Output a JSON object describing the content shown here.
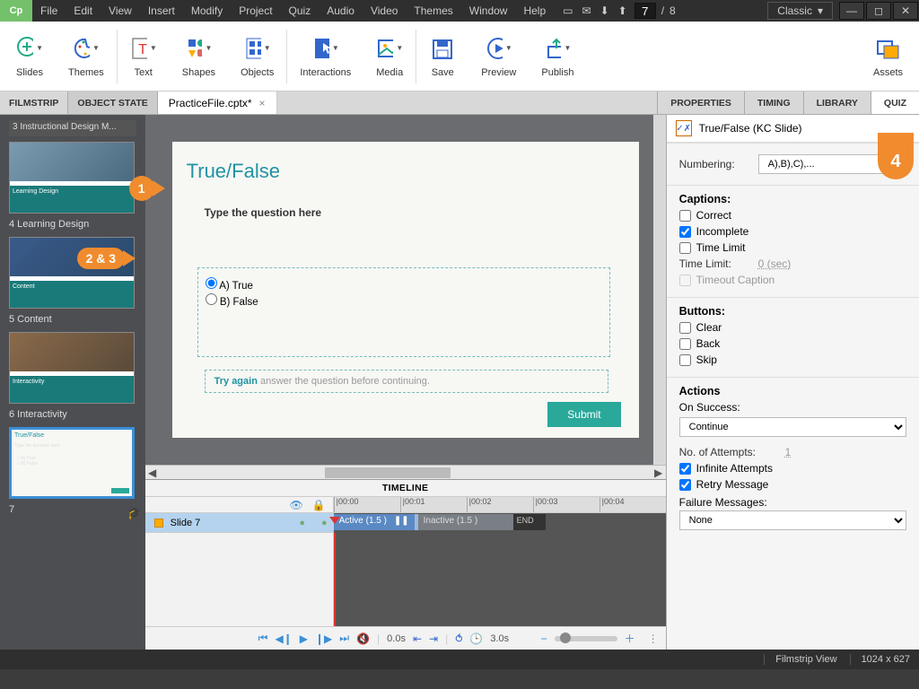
{
  "app": {
    "logo": "Cp"
  },
  "menu": [
    "File",
    "Edit",
    "View",
    "Insert",
    "Modify",
    "Project",
    "Quiz",
    "Audio",
    "Video",
    "Themes",
    "Window",
    "Help"
  ],
  "slideCounter": {
    "current": "7",
    "sep": "/",
    "total": "8"
  },
  "workspace": "Classic",
  "ribbon": [
    {
      "label": "Slides"
    },
    {
      "label": "Themes"
    },
    {
      "label": "Text"
    },
    {
      "label": "Shapes"
    },
    {
      "label": "Objects"
    },
    {
      "label": "Interactions"
    },
    {
      "label": "Media"
    },
    {
      "label": "Save"
    },
    {
      "label": "Preview"
    },
    {
      "label": "Publish"
    },
    {
      "label": "Assets"
    }
  ],
  "leftTabs": {
    "filmstrip": "FILMSTRIP",
    "objectState": "OBJECT STATE"
  },
  "fileTab": "PracticeFile.cptx*",
  "rightTabs": {
    "properties": "PROPERTIES",
    "timing": "TIMING",
    "library": "LIBRARY",
    "quiz": "QUIZ"
  },
  "filmstripPartial": "3 Instructional Design M...",
  "filmstrip": [
    {
      "label": "4 Learning Design",
      "bar": "Learning Design"
    },
    {
      "label": "5 Content",
      "bar": "Content"
    },
    {
      "label": "6 Interactivity",
      "bar": "Interactivity"
    },
    {
      "label": "7",
      "bar": "",
      "sel": true,
      "tf": true
    }
  ],
  "slide": {
    "title": "True/False",
    "question": "Type the question here",
    "optA": "A) True",
    "optB": "B) False",
    "tryAgain": "Try again",
    "tryAgainRest": " answer the question before continuing.",
    "submit": "Submit"
  },
  "callouts": {
    "c1": "1",
    "c23": "2 & 3",
    "c4": "4"
  },
  "timeline": {
    "header": "TIMELINE",
    "track": "Slide 7",
    "ticks": [
      "|00:00",
      "|00:01",
      "|00:02",
      "|00:03",
      "|00:04"
    ],
    "active": "Active (1.5 )",
    "inactive": "Inactive (1.5 )",
    "end": "END",
    "t0": "0.0s",
    "t3": "3.0s"
  },
  "quizPanel": {
    "title": "True/False (KC Slide)",
    "numberingLabel": "Numbering:",
    "numberingValue": "A),B),C),...",
    "captionsHdr": "Captions:",
    "correct": "Correct",
    "incomplete": "Incomplete",
    "timeLimitChk": "Time Limit",
    "timeLimitLabel": "Time Limit:",
    "timeLimitVal": "0 (sec)",
    "timeoutCaption": "Timeout Caption",
    "buttonsHdr": "Buttons:",
    "clear": "Clear",
    "back": "Back",
    "skip": "Skip",
    "actionsHdr": "Actions",
    "onSuccess": "On Success:",
    "onSuccessVal": "Continue",
    "attemptsLabel": "No. of Attempts:",
    "attemptsVal": "1",
    "infinite": "Infinite Attempts",
    "retry": "Retry Message",
    "failureLabel": "Failure Messages:",
    "failureVal": "None"
  },
  "status": {
    "view": "Filmstrip View",
    "dims": "1024 x 627"
  }
}
